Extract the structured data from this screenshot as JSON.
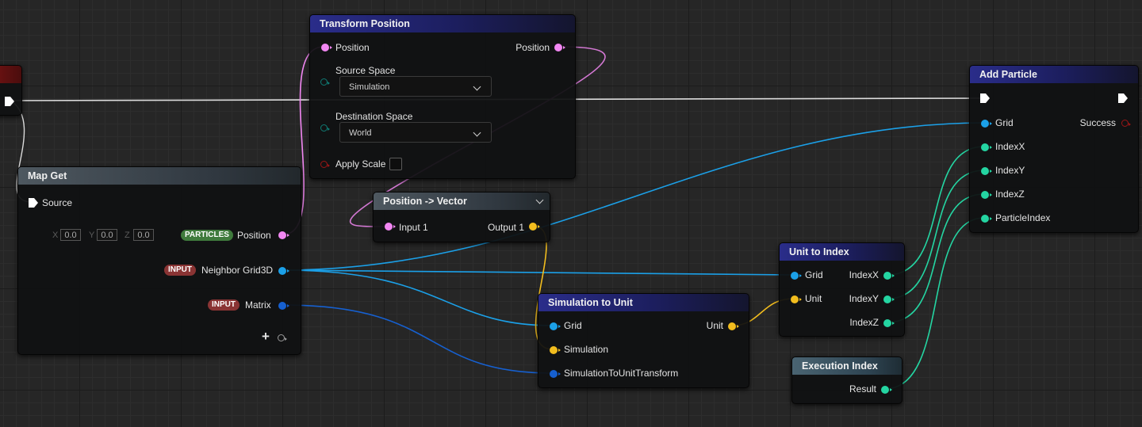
{
  "nodes": {
    "transform_position": {
      "title": "Transform Position",
      "input_position": "Position",
      "output_position": "Position",
      "source_space_label": "Source Space",
      "source_space_value": "Simulation",
      "destination_space_label": "Destination Space",
      "destination_space_value": "World",
      "apply_scale_label": "Apply Scale"
    },
    "map_get": {
      "title": "Map Get",
      "source_label": "Source",
      "vector_labels": [
        "X",
        "Y",
        "Z"
      ],
      "vector_values": [
        "0.0",
        "0.0",
        "0.0"
      ],
      "position_tag": "PARTICLES",
      "position_label": "Position",
      "grid_tag": "INPUT",
      "grid_label": "Neighbor Grid3D",
      "matrix_tag": "INPUT",
      "matrix_label": "Matrix",
      "add_pin_symbol": "+"
    },
    "position_vector": {
      "title": "Position -> Vector",
      "input_label": "Input 1",
      "output_label": "Output 1"
    },
    "simulation_to_unit": {
      "title": "Simulation to Unit",
      "grid_label": "Grid",
      "simulation_label": "Simulation",
      "transform_label": "SimulationToUnitTransform",
      "unit_label": "Unit"
    },
    "unit_to_index": {
      "title": "Unit to Index",
      "grid_label": "Grid",
      "unit_label": "Unit",
      "index_x": "IndexX",
      "index_y": "IndexY",
      "index_z": "IndexZ"
    },
    "execution_index": {
      "title": "Execution Index",
      "result_label": "Result"
    },
    "add_particle": {
      "title": "Add Particle",
      "grid_label": "Grid",
      "success_label": "Success",
      "index_x": "IndexX",
      "index_y": "IndexY",
      "index_z": "IndexZ",
      "particle_index": "ParticleIndex"
    }
  },
  "colors": {
    "position_pin": "#f287f2",
    "grid_pin": "#1ba0e8",
    "matrix_pin": "#1660d0",
    "vector_pin": "#f2bd1e",
    "int_pin": "#24d5a2",
    "bool_pin": "#9a1616",
    "enum_pin": "#0f7a73",
    "exec_wire": "#dcdcdc",
    "node_header_blue": "#2a2d8a"
  }
}
